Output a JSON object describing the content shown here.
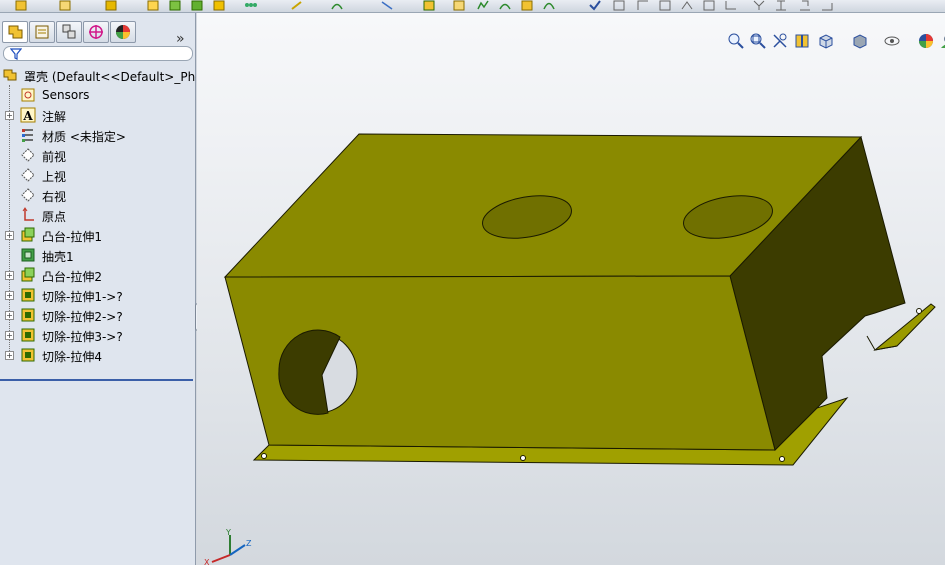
{
  "panel": {
    "tabs": [
      "feature-manager",
      "property-manager",
      "configuration-manager",
      "dimxpert-manager",
      "display-manager"
    ],
    "expand_glyph": "»",
    "filter_icon": "filter-icon"
  },
  "tree": {
    "root_label": "罩壳  (Default<<Default>_Phc",
    "items": [
      {
        "label": "Sensors",
        "icon": "sensors-icon",
        "expandable": false
      },
      {
        "label": "注解",
        "icon": "annotations-icon",
        "expandable": true
      },
      {
        "label": "材质 <未指定>",
        "icon": "material-icon",
        "expandable": false
      },
      {
        "label": "前视",
        "icon": "plane-icon",
        "expandable": false
      },
      {
        "label": "上视",
        "icon": "plane-icon",
        "expandable": false
      },
      {
        "label": "右视",
        "icon": "plane-icon",
        "expandable": false
      },
      {
        "label": "原点",
        "icon": "origin-icon",
        "expandable": false
      },
      {
        "label": "凸台-拉伸1",
        "icon": "boss-extrude-icon",
        "expandable": true
      },
      {
        "label": "抽壳1",
        "icon": "shell-icon",
        "expandable": false
      },
      {
        "label": "凸台-拉伸2",
        "icon": "boss-extrude-icon",
        "expandable": true
      },
      {
        "label": "切除-拉伸1->?",
        "icon": "cut-extrude-icon",
        "expandable": true
      },
      {
        "label": "切除-拉伸2->?",
        "icon": "cut-extrude-icon",
        "expandable": true
      },
      {
        "label": "切除-拉伸3->?",
        "icon": "cut-extrude-icon",
        "expandable": true
      },
      {
        "label": "切除-拉伸4",
        "icon": "cut-extrude-icon",
        "expandable": true
      }
    ]
  },
  "view_toolbar": [
    "zoom-to-fit-icon",
    "zoom-to-area-icon",
    "previous-view-icon",
    "section-view-icon",
    "view-orientation-icon",
    "display-style-icon",
    "hide-show-icon",
    "appearance-icon",
    "scene-icon",
    "view-settings-icon"
  ],
  "triad": {
    "x": "X",
    "y": "Y",
    "z": "Z"
  },
  "colors": {
    "model_face": "#8a8a00",
    "model_side": "#3c3c00",
    "model_dark": "#2a2a00",
    "panel_bg": "#dfe5ee",
    "selection_line": "#3b5fa8"
  }
}
